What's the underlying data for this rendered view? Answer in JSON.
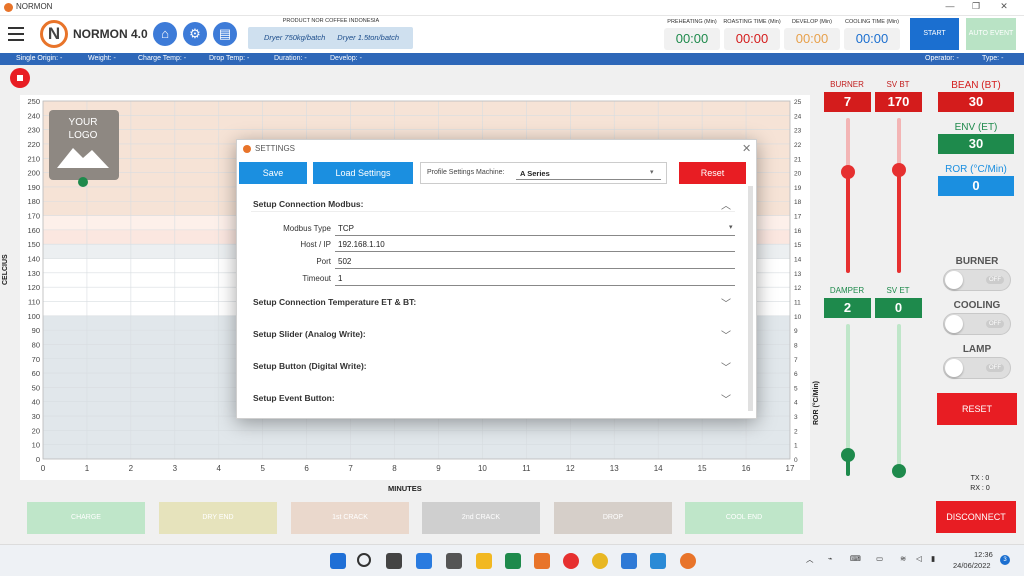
{
  "window": {
    "title": "NORMON"
  },
  "header": {
    "brand_text": "NORMON 4.0",
    "logo_letter": "N",
    "product_label": "PRODUCT NOR COFFEE INDONESIA",
    "products": [
      "Dryer 750kg/batch",
      "Dryer 1.5ton/batch"
    ],
    "timers": [
      {
        "label": "PREHEATING (Min)",
        "value": "00:00",
        "color": "#1e8a4c"
      },
      {
        "label": "ROASTING TIME (Min)",
        "value": "00:00",
        "color": "#d41c1c"
      },
      {
        "label": "DEVELOP (Min)",
        "value": "00:00",
        "color": "#e8a04a"
      },
      {
        "label": "COOLING TIME (Min)",
        "value": "00:00",
        "color": "#1b6fd0"
      }
    ],
    "start_label": "START",
    "auto_event_label": "AUTO EVENT"
  },
  "infobar": {
    "single_origin": "Single Origin: -",
    "weight": "Weight: -",
    "charge_temp": "Charge Temp: -",
    "drop_temp": "Drop Temp: -",
    "duration": "Duration: -",
    "develop": "Develop: -",
    "operator": "Operator: -",
    "type": "Type: -"
  },
  "chart_data": {
    "type": "line",
    "title": "",
    "xlabel": "MINUTES",
    "ylabel": "CELCIUS",
    "y2label": "ROR (°C/Min)",
    "xlim": [
      0,
      17
    ],
    "ylim": [
      0,
      250
    ],
    "y2lim": [
      0,
      25
    ],
    "x_ticks": [
      0,
      1,
      2,
      3,
      4,
      5,
      6,
      7,
      8,
      9,
      10,
      11,
      12,
      13,
      14,
      15,
      16,
      17
    ],
    "y_ticks": [
      0,
      10,
      20,
      30,
      40,
      50,
      60,
      70,
      80,
      90,
      100,
      110,
      120,
      130,
      140,
      150,
      160,
      170,
      180,
      190,
      200,
      210,
      220,
      230,
      240,
      250
    ],
    "y2_ticks": [
      0,
      1,
      2,
      3,
      4,
      5,
      6,
      7,
      8,
      9,
      10,
      11,
      12,
      13,
      14,
      15,
      16,
      17,
      18,
      19,
      20,
      21,
      22,
      23,
      24,
      25
    ],
    "bands": [
      {
        "from": 170,
        "to": 250,
        "color": "#f6e3d6"
      },
      {
        "from": 160,
        "to": 170,
        "color": "#fdf0ea"
      },
      {
        "from": 150,
        "to": 160,
        "color": "#fbe7e0"
      },
      {
        "from": 140,
        "to": 150,
        "color": "#eceff1"
      },
      {
        "from": 100,
        "to": 140,
        "color": "#ffffff"
      },
      {
        "from": 0,
        "to": 100,
        "color": "#e1e7eb"
      }
    ],
    "series": [],
    "grid": true,
    "logo_text": "YOUR LOGO"
  },
  "events": [
    {
      "label": "CHARGE",
      "color": "#bfe6c9"
    },
    {
      "label": "DRY END",
      "color": "#e6e3bc"
    },
    {
      "label": "1st CRACK",
      "color": "#ead8cc"
    },
    {
      "label": "2nd CRACK",
      "color": "#cfcfcf"
    },
    {
      "label": "DROP",
      "color": "#d6cfc9"
    },
    {
      "label": "COOL END",
      "color": "#bfe6c9"
    }
  ],
  "controls": {
    "burner": {
      "label": "BURNER",
      "value": "7",
      "level": 0.7
    },
    "sv_bt": {
      "label": "SV BT",
      "value": "170",
      "level": 0.7
    },
    "damper": {
      "label": "DAMPER",
      "value": "2",
      "level": 0.2
    },
    "sv_et": {
      "label": "SV ET",
      "value": "0",
      "level": 0
    }
  },
  "readings": {
    "bean": {
      "label": "BEAN (BT)",
      "value": "30"
    },
    "env": {
      "label": "ENV (ET)",
      "value": "30"
    },
    "ror": {
      "label": "ROR (°C/Min)",
      "value": "0"
    }
  },
  "toggles": [
    {
      "label": "BURNER",
      "state": "OFF"
    },
    {
      "label": "COOLING",
      "state": "OFF"
    },
    {
      "label": "LAMP",
      "state": "OFF"
    }
  ],
  "reset_label": "RESET",
  "tx": "TX : 0",
  "rx": "RX : 0",
  "disconnect_label": "DISCONNECT",
  "dialog": {
    "title": "SETTINGS",
    "save_label": "Save",
    "load_label": "Load Settings",
    "profile_label": "Profile Settings Machine:",
    "profile_value": "A Series",
    "reset_label": "Reset",
    "sections": [
      "Setup Connection Modbus:",
      "Setup Connection Temperature ET & BT:",
      "Setup Slider (Analog Write):",
      "Setup Button (Digital Write):",
      "Setup Event Button:"
    ],
    "modbus": {
      "type_label": "Modbus Type",
      "type_value": "TCP",
      "host_label": "Host / IP",
      "host_value": "192.168.1.10",
      "port_label": "Port",
      "port_value": "502",
      "timeout_label": "Timeout",
      "timeout_value": "1"
    }
  },
  "taskbar": {
    "time": "12:36",
    "date": "24/06/2022",
    "badge": "3"
  }
}
